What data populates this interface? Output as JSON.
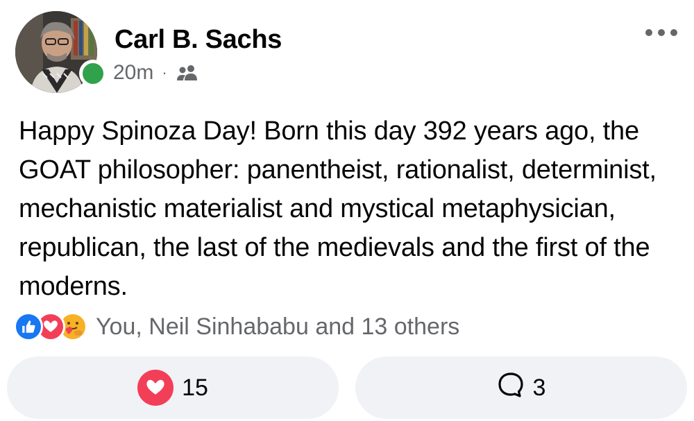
{
  "post": {
    "author_name": "Carl B. Sachs",
    "timestamp": "20m",
    "separator": "·",
    "audience_icon": "friends-icon",
    "text": "Happy Spinoza Day! Born this day 392 years ago, the GOAT philosopher: panentheist, rationalist, determinist, mechanistic materialist and mystical metaphysician, republican, the last of the medievals and the first of the moderns."
  },
  "reactions": {
    "icons": [
      "like-reaction-icon",
      "love-reaction-icon",
      "care-reaction-icon"
    ],
    "summary": "You, Neil Sinhababu and 13 others"
  },
  "actions": {
    "like_count": "15",
    "comment_count": "3"
  },
  "colors": {
    "online": "#31a24c",
    "like_blue": "#1877f2",
    "love_red": "#f33e58",
    "care_yellow": "#f7b125",
    "button_bg": "#f0f2f5",
    "secondary_text": "#65676b"
  }
}
